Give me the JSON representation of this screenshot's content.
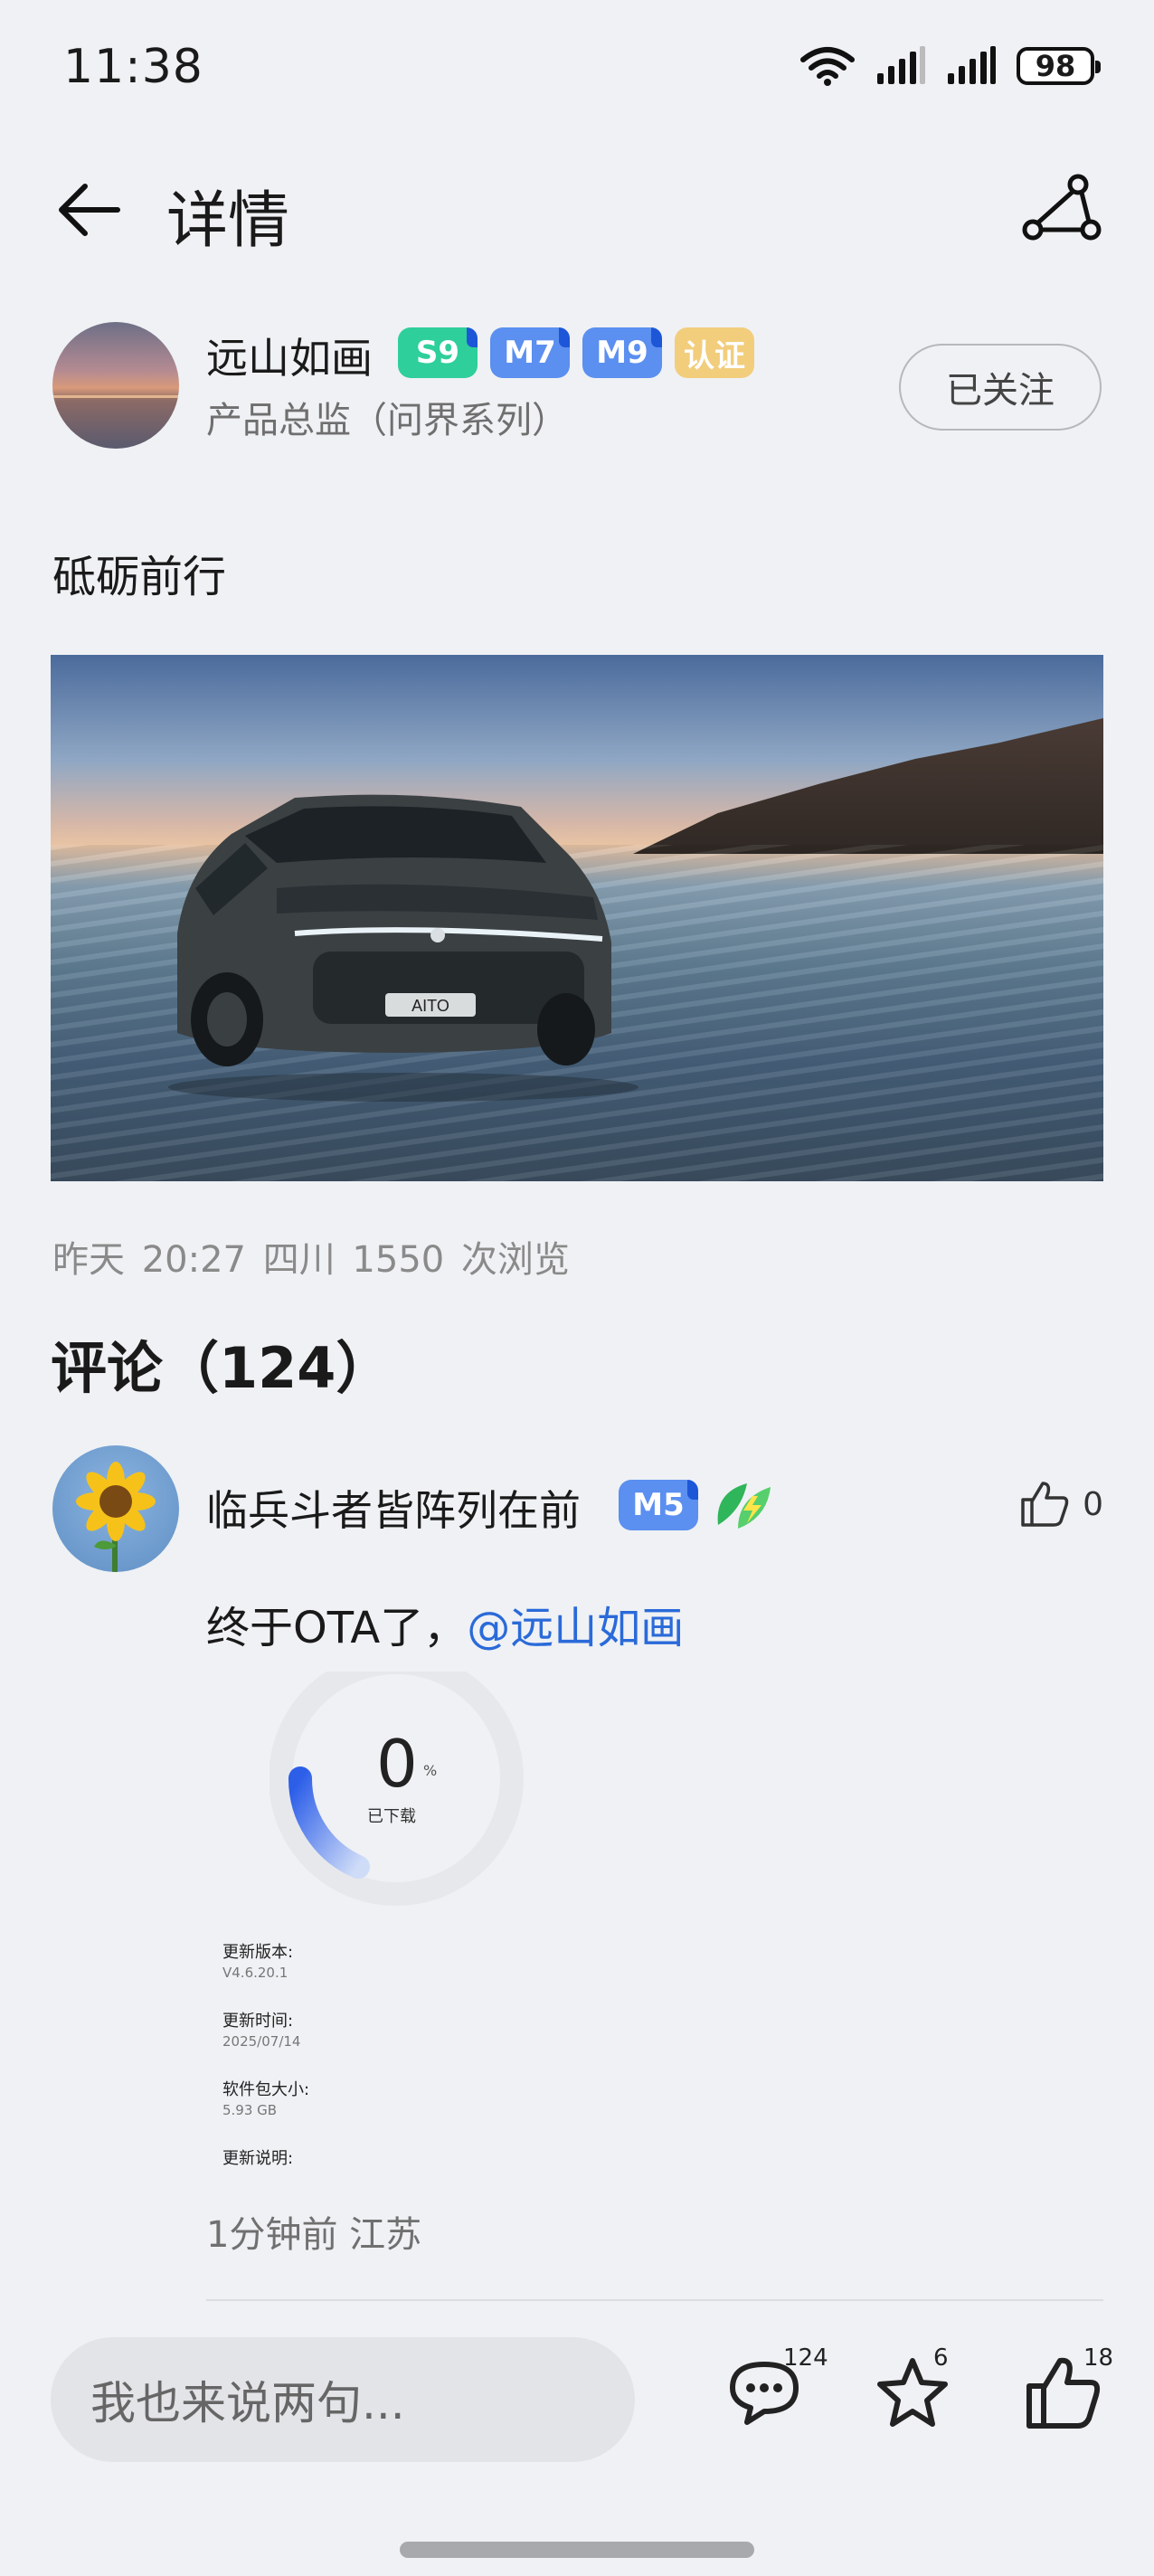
{
  "status_bar": {
    "time": "11:38",
    "battery": "98"
  },
  "header": {
    "title": "详情"
  },
  "author": {
    "name": "远山如画",
    "badges": [
      {
        "label": "S9",
        "color": "#2ecf9b"
      },
      {
        "label": "M7",
        "color": "#5b8ff0"
      },
      {
        "label": "M9",
        "color": "#5b8ff0"
      },
      {
        "label": "认证",
        "color": "#f2cd7c"
      }
    ],
    "subtitle": "产品总监（问界系列）",
    "follow_label": "已关注"
  },
  "post": {
    "text": "砥砺前行",
    "image_plate": "AITO",
    "meta": "昨天 20:27  四川  1550 次浏览"
  },
  "comments": {
    "title": "评论（124）",
    "items": [
      {
        "name": "临兵斗者皆阵列在前",
        "badge": {
          "label": "M5",
          "color": "#5b8ff0"
        },
        "likes": "0",
        "text": "终于OTA了，",
        "mention": "@远山如画",
        "ota": {
          "percent": 0,
          "percent_text": "0",
          "unit": "%",
          "downloaded_label": "已下载",
          "rows": [
            {
              "label": "更新版本:",
              "value": "V4.6.20.1"
            },
            {
              "label": "更新时间:",
              "value": "2025/07/14"
            },
            {
              "label": "软件包大小:",
              "value": "5.93 GB"
            },
            {
              "label": "更新说明:",
              "value": ""
            }
          ]
        },
        "meta": "1分钟前 江苏"
      }
    ]
  },
  "bottom_bar": {
    "input_placeholder": "我也来说两句...",
    "comment_count": "124",
    "favorite_count": "6",
    "like_count": "18"
  },
  "icons": [
    "wifi-icon",
    "signal-icon",
    "battery-icon",
    "back-arrow-icon",
    "share-icon",
    "thumbs-up-icon",
    "comment-icon",
    "star-icon",
    "leaf-bolt-icon"
  ]
}
